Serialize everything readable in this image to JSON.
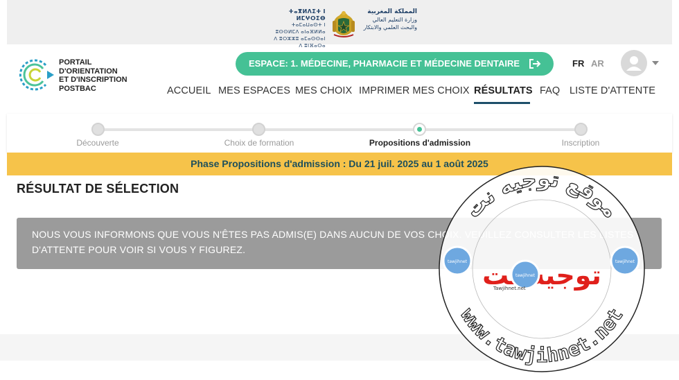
{
  "government": {
    "tifinagh_line1": "ⵜⴰⴳⵍⴷⵉⵜ ⵏ ⵍⵎⵖⵔⵉⴱ",
    "tifinagh_line2": "ⵜⴰⵎⴰⵡⴰⵙⵜ ⵏ ⵓⵙⵙⵍⵎⴷ ⴰⵏⴰⴼⵍⵍⴰ",
    "tifinagh_line3": "ⴷ ⵓⵔⵣⵣⵓ ⴰⵎⴰⵙⵙⴰⵏ ⴷ ⵓⵏⴼⴰⵔⴰ",
    "arabic_line1": "المملكة المغربية",
    "arabic_line2": "وزارة التعليم العالي",
    "arabic_line3": "والبحث العلمي والابتكار"
  },
  "brand": {
    "line1": "PORTAIL",
    "line2": "D'ORIENTATION",
    "line3": "ET D'INSCRIPTION",
    "line4": "POSTBAC"
  },
  "espace": {
    "label": "ESPACE: 1. MÉDECINE, PHARMACIE ET MÉDECINE DENTAIRE"
  },
  "languages": {
    "fr": "FR",
    "ar": "AR"
  },
  "nav": {
    "accueil": "ACCUEIL",
    "mes_espaces": "MES ESPACES",
    "mes_choix": "MES CHOIX",
    "imprimer": "IMPRIMER MES CHOIX",
    "resultats": "RÉSULTATS",
    "faq": "FAQ",
    "liste_attente": "LISTE D'ATTENTE"
  },
  "steps": [
    {
      "label": "Découverte",
      "state": "done"
    },
    {
      "label": "Choix de formation",
      "state": "done"
    },
    {
      "label": "Propositions d'admission",
      "state": "current"
    },
    {
      "label": "Inscription",
      "state": "upcoming"
    }
  ],
  "phase_banner": "Phase Propositions d'admission : Du 21 juil. 2025 au 1 août 2025",
  "result": {
    "title": "RÉSULTAT DE SÉLECTION",
    "message": "NOUS VOUS INFORMONS QUE VOUS N'ÊTES PAS ADMIS(E) DANS AUCUN DE VOS CHOIX. VEUILLEZ CONSULTER LES LISTES D'ATTENTE POUR VOIR SI VOUS Y FIGUREZ."
  },
  "watermark": {
    "arabic_arc": "موقع توجيه نت",
    "arabic_center": "توجيه نت",
    "latin_arc": "www.tawjihnet.net",
    "small_label": "Tawjihnet.net",
    "bubble_label": "tawjihnet"
  },
  "colors": {
    "accent_green": "#45c195",
    "phase_yellow": "#f6c34a",
    "nav_underline": "#1e4f6a",
    "alert_grey": "#9b9b9b",
    "watermark_red": "#e0201b"
  }
}
